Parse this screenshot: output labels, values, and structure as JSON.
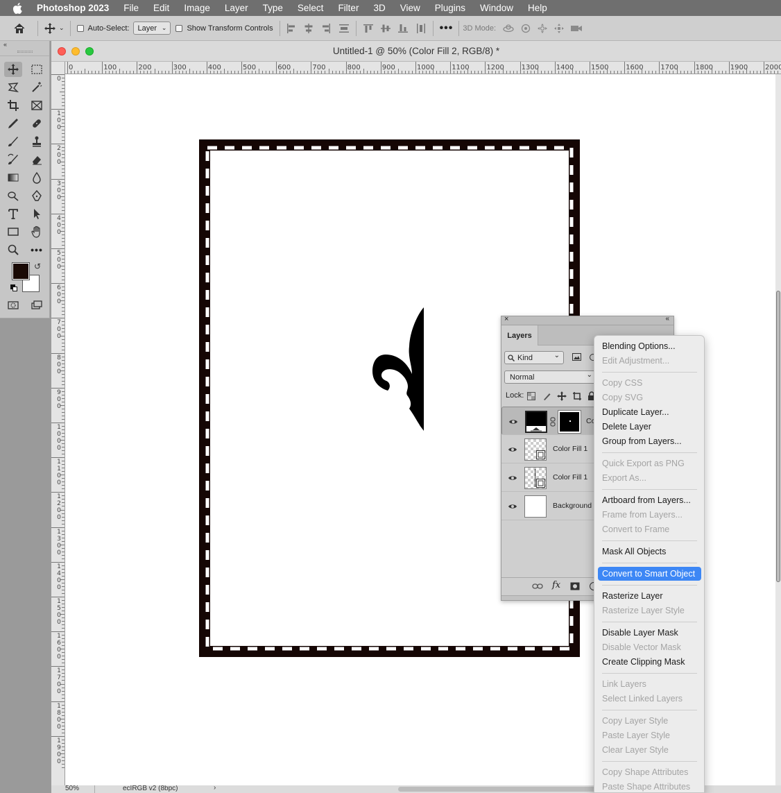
{
  "menubar": {
    "app_name": "Photoshop 2023",
    "items": [
      "File",
      "Edit",
      "Image",
      "Layer",
      "Type",
      "Select",
      "Filter",
      "3D",
      "View",
      "Plugins",
      "Window",
      "Help"
    ]
  },
  "options_bar": {
    "auto_select_label": "Auto-Select:",
    "auto_select_target": "Layer",
    "show_transform_label": "Show Transform Controls",
    "mode_3d_label": "3D Mode:"
  },
  "document": {
    "title": "Untitled-1 @ 50% (Color Fill 2, RGB/8) *",
    "zoom": "50%",
    "color_profile": "ecIRGB v2 (8bpc)",
    "ruler_h": [
      "0",
      "100",
      "200",
      "300",
      "400",
      "500",
      "600",
      "700",
      "800",
      "900",
      "1000",
      "1100",
      "1200",
      "1300",
      "1400",
      "1500",
      "1600",
      "1700",
      "1800",
      "1900",
      "2000"
    ],
    "ruler_v": [
      "0",
      "1 0 0",
      "2 0 0",
      "3 0 0",
      "4 0 0",
      "5 0 0",
      "6 0 0",
      "7 0 0",
      "8 0 0",
      "9 0 0",
      "1 0 0 0",
      "1 1 0 0",
      "1 2 0 0",
      "1 3 0 0",
      "1 4 0 0",
      "1 5 0 0",
      "1 6 0 0",
      "1 7 0 0",
      "1 8 0 0",
      "1 9 0 0"
    ]
  },
  "layers_panel": {
    "tab_label": "Layers",
    "filter_kind": "Kind",
    "blend_mode": "Normal",
    "lock_label": "Lock:",
    "layers": [
      {
        "name": "Co",
        "selected": true
      },
      {
        "name": "Color Fill 1",
        "selected": false
      },
      {
        "name": "Color Fill 1",
        "selected": false
      },
      {
        "name": "Background",
        "selected": false
      }
    ]
  },
  "context_menu": {
    "groups": [
      [
        {
          "label": "Blending Options...",
          "enabled": true
        },
        {
          "label": "Edit Adjustment...",
          "enabled": false
        }
      ],
      [
        {
          "label": "Copy CSS",
          "enabled": false
        },
        {
          "label": "Copy SVG",
          "enabled": false
        },
        {
          "label": "Duplicate Layer...",
          "enabled": true
        },
        {
          "label": "Delete Layer",
          "enabled": true
        },
        {
          "label": "Group from Layers...",
          "enabled": true
        }
      ],
      [
        {
          "label": "Quick Export as PNG",
          "enabled": false
        },
        {
          "label": "Export As...",
          "enabled": false
        }
      ],
      [
        {
          "label": "Artboard from Layers...",
          "enabled": true
        },
        {
          "label": "Frame from Layers...",
          "enabled": false
        },
        {
          "label": "Convert to Frame",
          "enabled": false
        }
      ],
      [
        {
          "label": "Mask All Objects",
          "enabled": true
        }
      ],
      [
        {
          "label": "Convert to Smart Object",
          "enabled": true,
          "highlighted": true
        }
      ],
      [
        {
          "label": "Rasterize Layer",
          "enabled": true
        },
        {
          "label": "Rasterize Layer Style",
          "enabled": false
        }
      ],
      [
        {
          "label": "Disable Layer Mask",
          "enabled": true
        },
        {
          "label": "Disable Vector Mask",
          "enabled": false
        },
        {
          "label": "Create Clipping Mask",
          "enabled": true
        }
      ],
      [
        {
          "label": "Link Layers",
          "enabled": false
        },
        {
          "label": "Select Linked Layers",
          "enabled": false
        }
      ],
      [
        {
          "label": "Copy Layer Style",
          "enabled": false
        },
        {
          "label": "Paste Layer Style",
          "enabled": false
        },
        {
          "label": "Clear Layer Style",
          "enabled": false
        }
      ],
      [
        {
          "label": "Copy Shape Attributes",
          "enabled": false
        },
        {
          "label": "Paste Shape Attributes",
          "enabled": false
        }
      ]
    ]
  },
  "colors": {
    "foreground": "#1a0a05",
    "background": "#ffffff",
    "menu_highlight": "#3d87f5"
  }
}
